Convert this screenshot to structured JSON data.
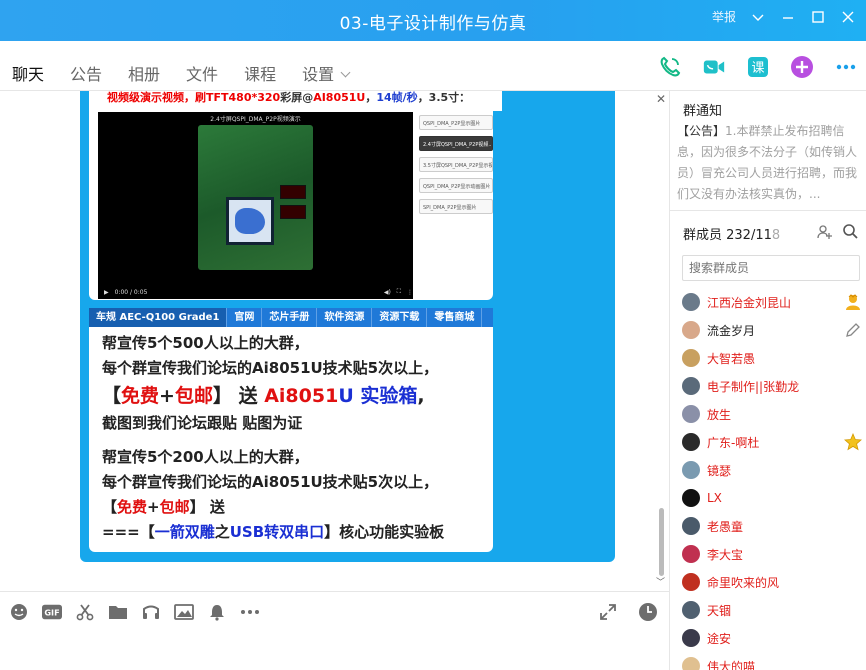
{
  "window": {
    "title": "03-电子设计制作与仿真",
    "report_label": "举报"
  },
  "tabs": [
    {
      "label": "聊天"
    },
    {
      "label": "公告"
    },
    {
      "label": "相册"
    },
    {
      "label": "文件"
    },
    {
      "label": "课程"
    },
    {
      "label": "设置"
    }
  ],
  "nav_icons": [
    "phone-icon",
    "video-call-icon",
    "course-icon",
    "add-app-icon",
    "more-icon"
  ],
  "message": {
    "headline_parts": [
      "视频级演示视频，刷",
      "TFT480*320",
      "彩屏@",
      "AI8051U",
      "，",
      "14帧/秒",
      "，3.5寸："
    ],
    "video": {
      "caption": "2.4寸屏QSPI_DMA_P2P视频演示",
      "time": "0:00 / 0:05",
      "playlist": [
        "QSPI_DMA_P2P显示图片",
        "2.4寸屏QSPI_DMA_P2P视频...",
        "3.5寸屏QSPI_DMA_P2P显示视频",
        "QSPI_DMA_P2P显示动画图片",
        "SPI_DMA_P2P显示图片"
      ]
    },
    "site_nav": [
      "车规 AEC-Q100 Grade1",
      "官网",
      "芯片手册",
      "软件资源",
      "资源下载",
      "零售商城"
    ],
    "promo": {
      "l1": "帮宣传5个500人以上的大群，",
      "l2": "每个群宣传我们论坛的Ai8051U技术贴5次以上，",
      "l3_a": "【",
      "l3_free": "免费",
      "l3_plus": "+",
      "l3_mail": "包邮",
      "l3_b": "】 送 ",
      "l3_ai": "Ai8051",
      "l3_u": "U",
      "l3_box": " 实验箱",
      "l3_end": ",",
      "l4": "截图到我们论坛跟贴 贴图为证",
      "l5": "帮宣传5个200人以上的大群，",
      "l6": "每个群宣传我们论坛的Ai8051U技术贴5次以上，",
      "l7_a": "【",
      "l7_free": "免费",
      "l7_plus": "+",
      "l7_mail": "包邮",
      "l7_b": "】 送",
      "l8_a": "===【",
      "l8_arrow": "一箭双雕",
      "l8_zhi": "之",
      "l8_usb": "USB转双串口",
      "l8_b": "】核心功能实验板"
    }
  },
  "toolbar": {
    "left": [
      "emoji-icon",
      "gif-icon",
      "screenshot-scissors-icon",
      "folder-icon",
      "music-icon",
      "image-icon",
      "bell-icon",
      "more-icon"
    ],
    "gif_label": "GIF",
    "right": [
      "expand-icon",
      "history-clock-icon"
    ]
  },
  "side": {
    "notice_title": "群通知",
    "notice_tag": "【公告】",
    "notice_text": "1.本群禁止发布招聘信息，因为很多不法分子（如传销人员）冒充公司人员进行招聘，而我们又没有办法核实真伪，...",
    "members_title": "群成员 232/11",
    "members_fade": "8",
    "search_placeholder": "搜索群成员",
    "members": [
      {
        "name": "江西冶金刘昆山",
        "color": "#e0201c",
        "avatar": "#6a7a8a",
        "badge": "owner"
      },
      {
        "name": "流金岁月",
        "color": "#222222",
        "avatar": "#d8a88a",
        "badge": "edit"
      },
      {
        "name": "大智若愚",
        "color": "#e0201c",
        "avatar": "#c8a060",
        "badge": ""
      },
      {
        "name": "电子制作||张勤龙",
        "color": "#e0201c",
        "avatar": "#5a6a7a",
        "badge": ""
      },
      {
        "name": "放生",
        "color": "#e0201c",
        "avatar": "#8a90a8",
        "badge": ""
      },
      {
        "name": "广东-啊杜",
        "color": "#e0201c",
        "avatar": "#2a2a2a",
        "badge": "admin"
      },
      {
        "name": "镜瑟",
        "color": "#e0201c",
        "avatar": "#7a9ab0",
        "badge": ""
      },
      {
        "name": "LX",
        "color": "#e0201c",
        "avatar": "#111111",
        "badge": ""
      },
      {
        "name": "老愚童",
        "color": "#e0201c",
        "avatar": "#4a5a6a",
        "badge": ""
      },
      {
        "name": "李大宝",
        "color": "#e0201c",
        "avatar": "#c03050",
        "badge": ""
      },
      {
        "name": "命里吹来的风",
        "color": "#e0201c",
        "avatar": "#c03020",
        "badge": ""
      },
      {
        "name": "天锢",
        "color": "#e0201c",
        "avatar": "#506070",
        "badge": ""
      },
      {
        "name": "途安",
        "color": "#e0201c",
        "avatar": "#3a3a4a",
        "badge": ""
      },
      {
        "name": "伟大的喵",
        "color": "#e0201c",
        "avatar": "#e0c090",
        "badge": ""
      }
    ]
  }
}
